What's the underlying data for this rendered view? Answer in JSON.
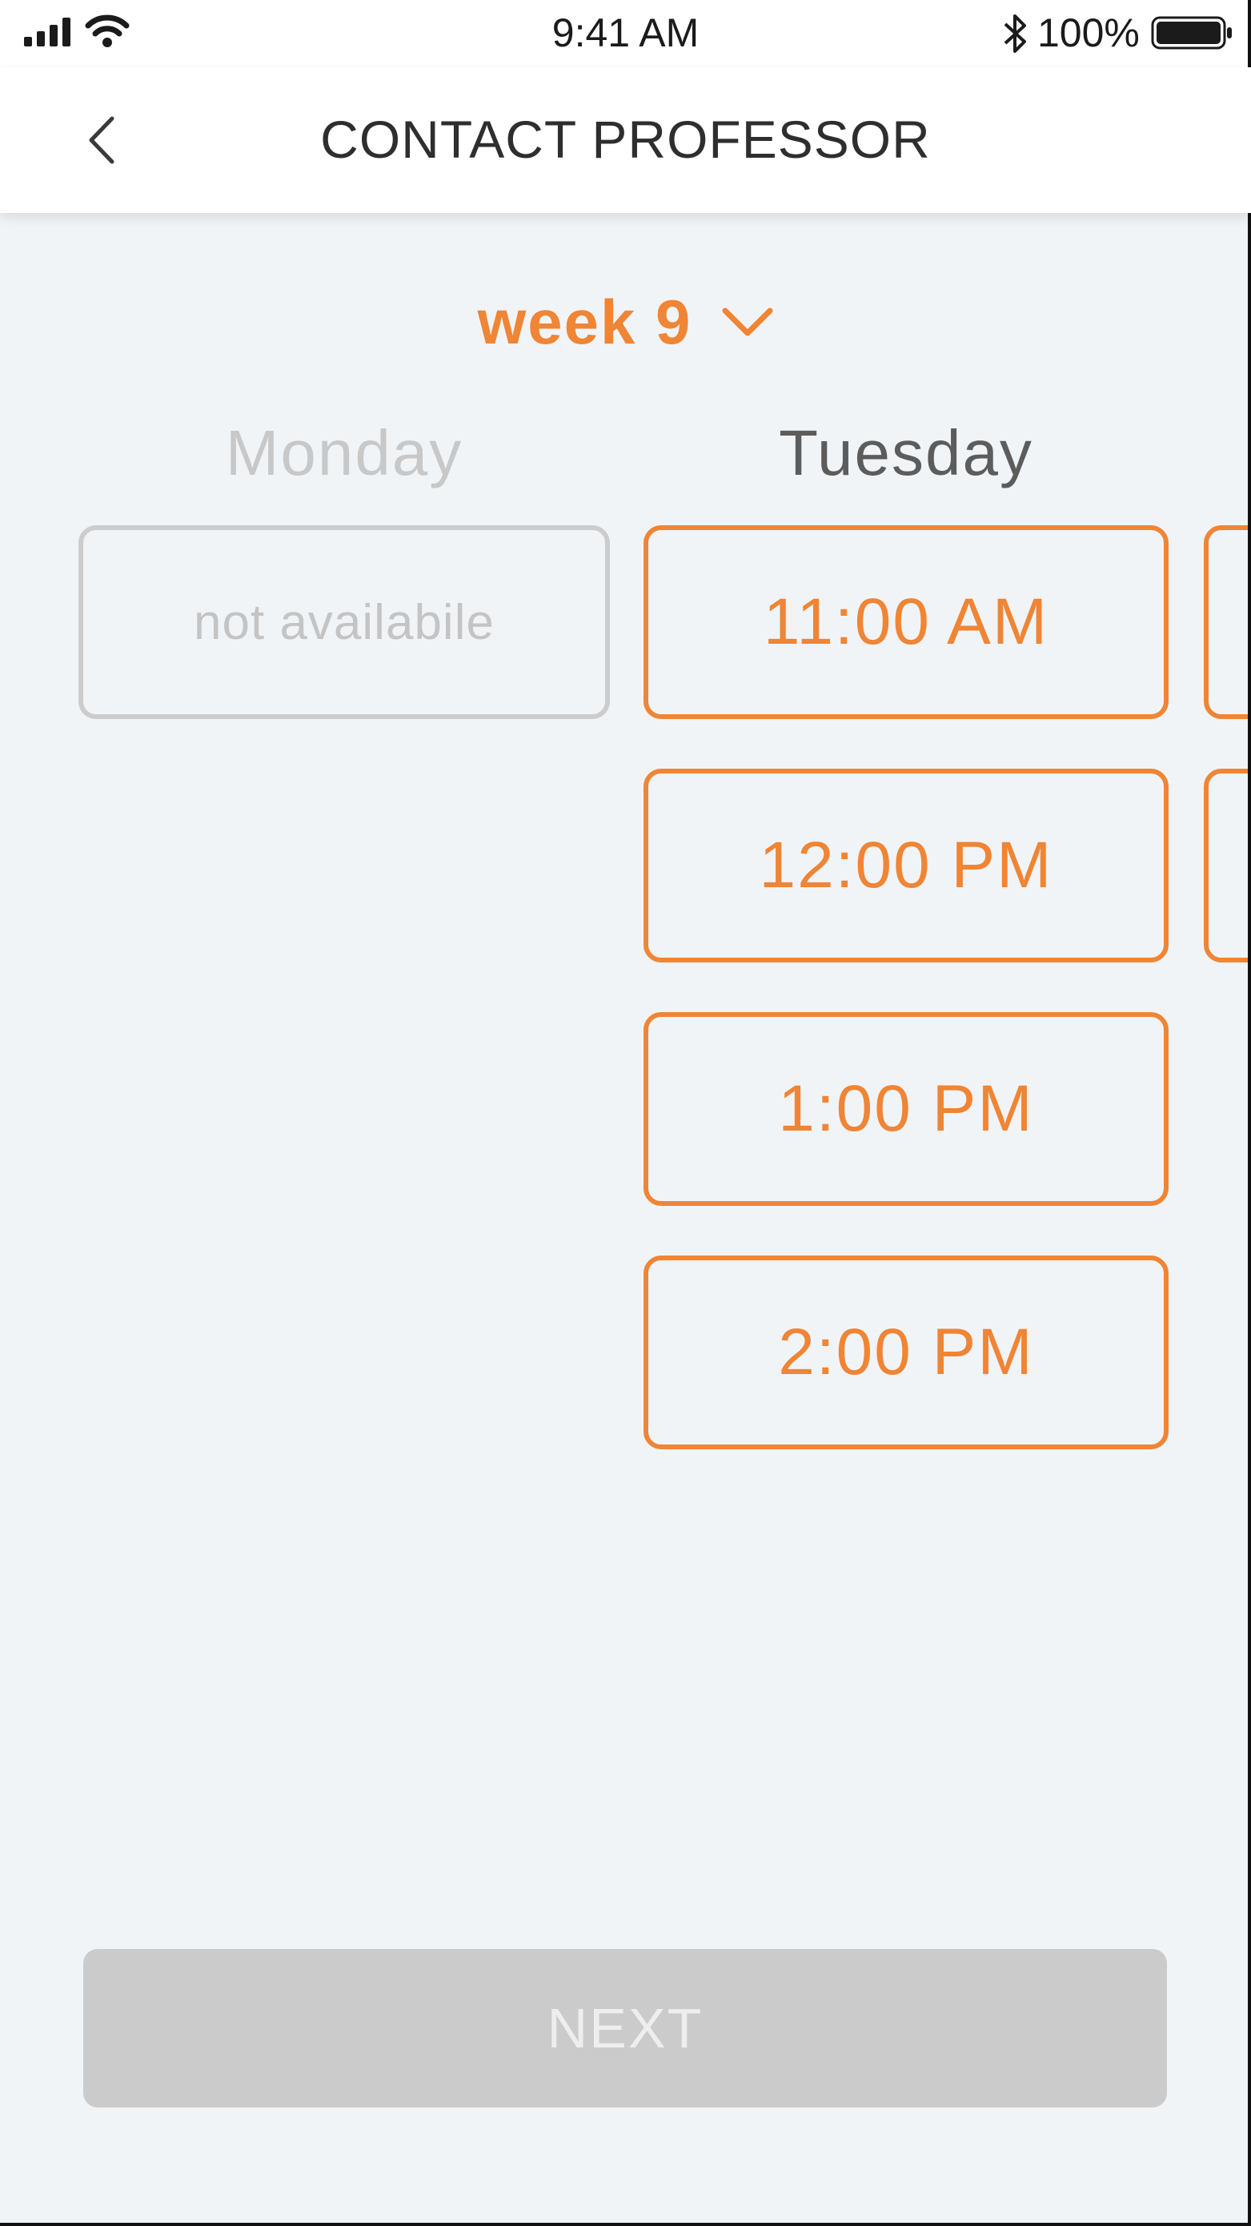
{
  "status_bar": {
    "time": "9:41 AM",
    "battery_percent": "100%",
    "icons": [
      "signal-icon",
      "wifi-icon",
      "bluetooth-icon",
      "battery-icon"
    ]
  },
  "nav": {
    "title": "CONTACT PROFESSOR",
    "back_icon": "chevron-left-icon"
  },
  "week_selector": {
    "label": "week 9",
    "icon": "chevron-down-icon"
  },
  "days": [
    {
      "name": "Monday",
      "status": "not availabile"
    },
    {
      "name": "Tuesday",
      "slots": [
        "11:00 AM",
        "12:00 PM",
        "1:00 PM",
        "2:00 PM"
      ]
    }
  ],
  "next_button": {
    "label": "NEXT",
    "enabled": false
  },
  "colors": {
    "accent": "#ef8535",
    "background": "#f1f4f7",
    "disabled": "#cbcbcb"
  }
}
